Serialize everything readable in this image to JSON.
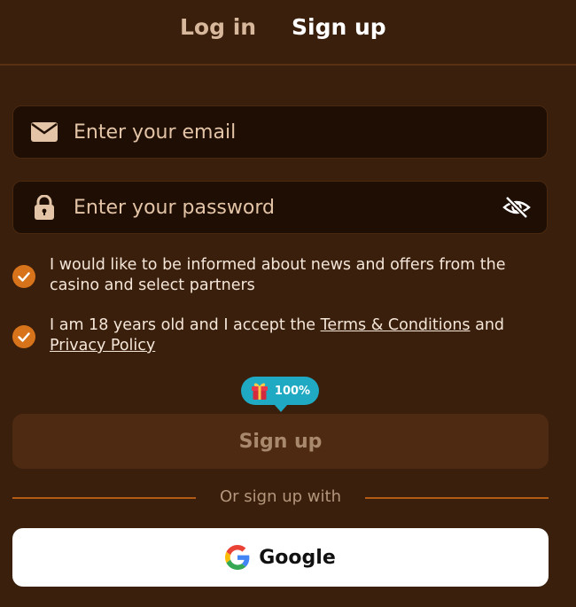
{
  "tabs": {
    "login": "Log in",
    "signup": "Sign up"
  },
  "email": {
    "placeholder": "Enter your email",
    "value": "",
    "icon": "mail-icon"
  },
  "password": {
    "placeholder": "Enter your password",
    "value": "",
    "icon": "lock-icon",
    "toggle_icon": "eye-off-icon"
  },
  "checkboxes": {
    "news": {
      "checked": true,
      "text": "I would like to be informed about news and offers from the casino and select partners"
    },
    "terms": {
      "checked": true,
      "prefix": "I am 18 years old and I accept the ",
      "terms_link": "Terms & Conditions",
      "middle": " and ",
      "privacy_link": "Privacy Policy"
    }
  },
  "badge": {
    "icon": "gift-icon",
    "text": "100%"
  },
  "submit": {
    "label": "Sign up"
  },
  "divider": {
    "text": "Or sign up with"
  },
  "google": {
    "label": "Google",
    "icon": "google-icon"
  },
  "colors": {
    "background": "#3a1f0c",
    "input_bg": "#1e0e04",
    "accent": "#d7731b",
    "badge": "#1fa9c2",
    "submit_bg": "#4e2a12"
  }
}
